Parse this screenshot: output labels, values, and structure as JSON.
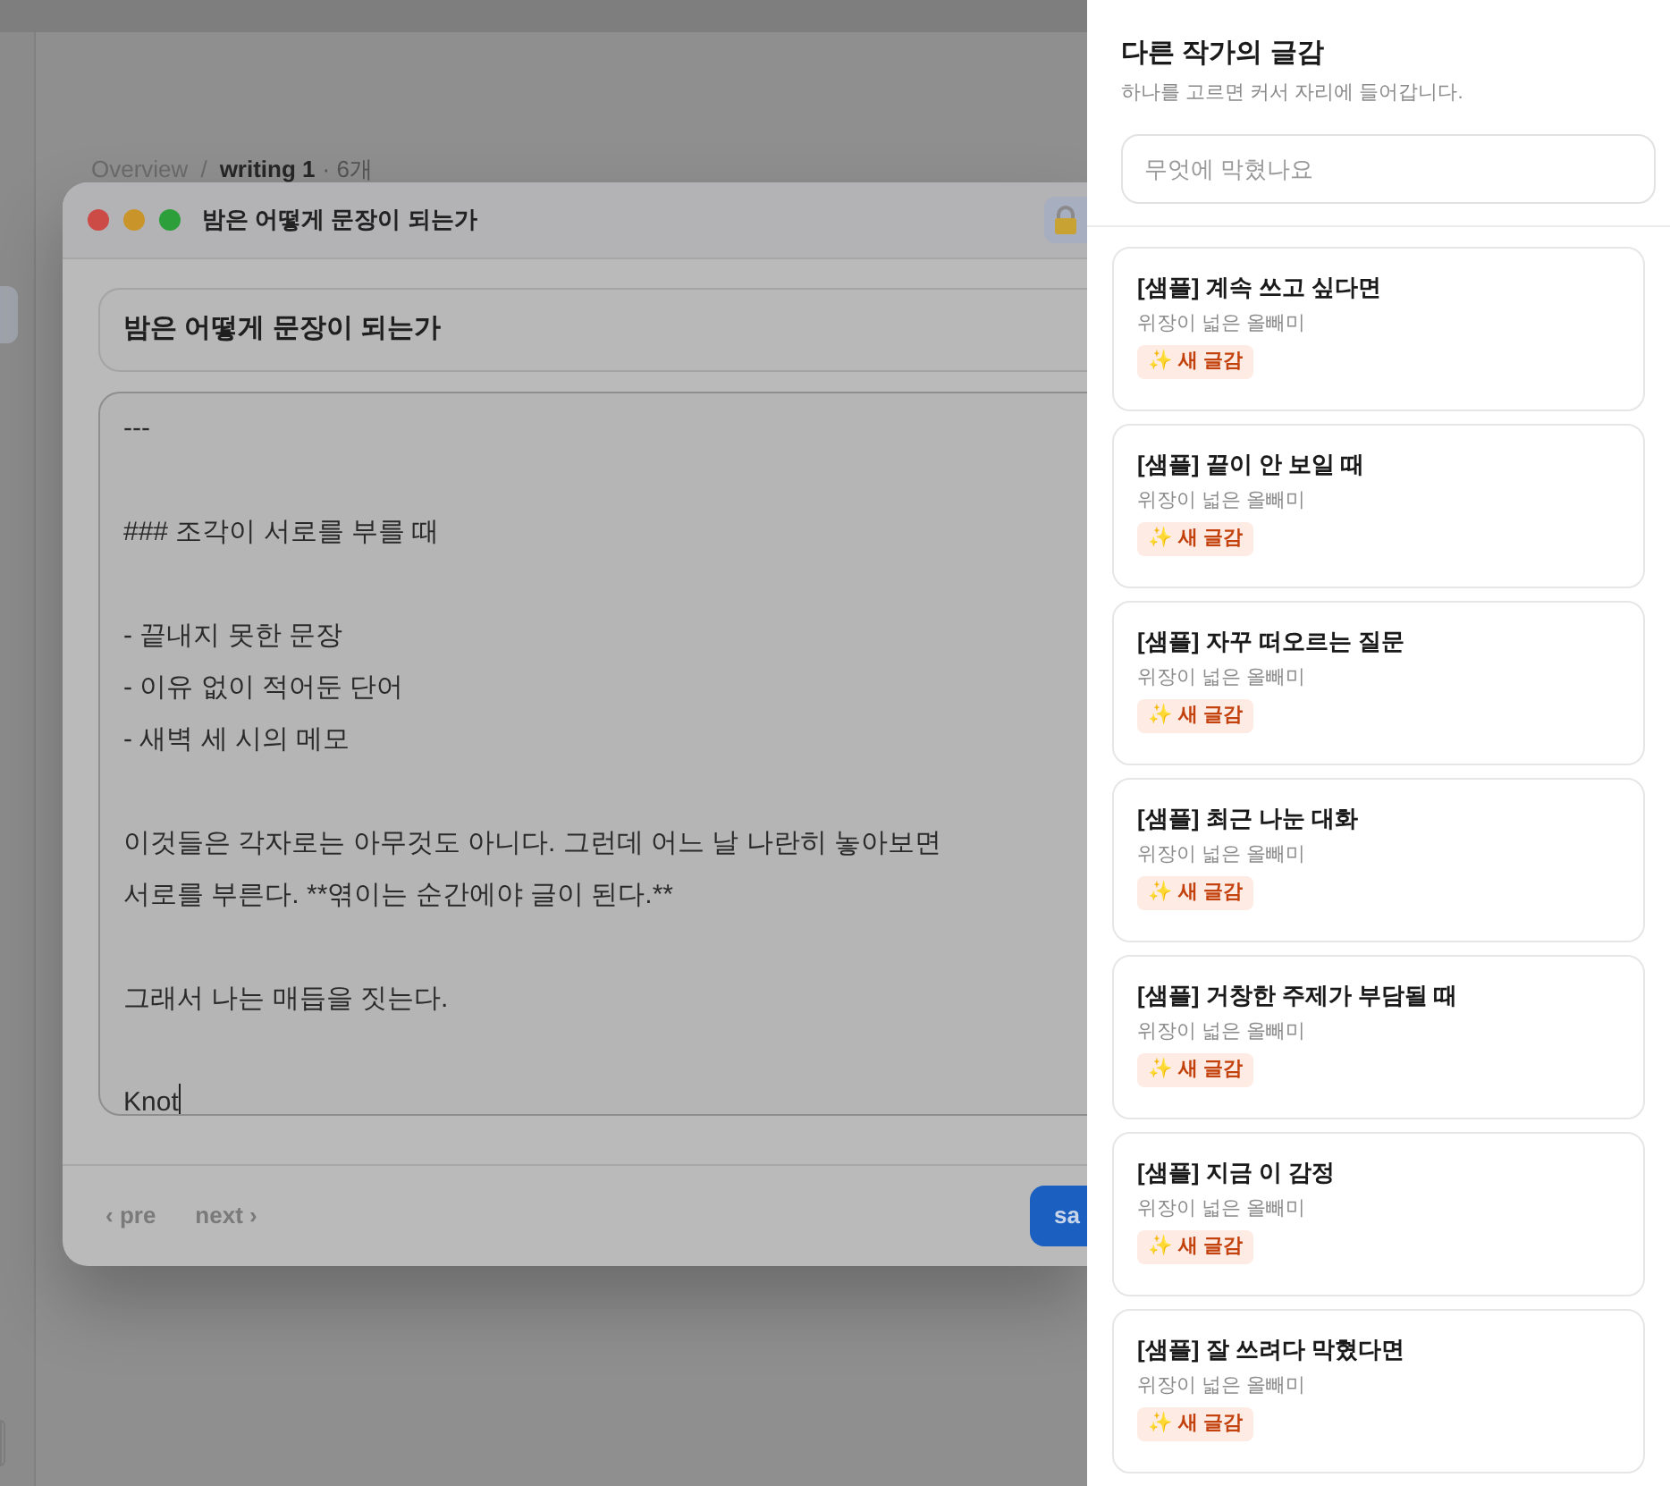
{
  "breadcrumb": {
    "root": "Overview",
    "separator": "/",
    "current": "writing 1",
    "count": "· 6개"
  },
  "dialog": {
    "title": "밤은 어떻게 문장이 되는가",
    "doc_title": "밤은 어떻게 문장이 되는가",
    "body": [
      [
        "---"
      ],
      [
        "### 조각이 서로를 부를 때"
      ],
      [
        "- 끝내지 못한 문장",
        "- 이유 없이 적어둔 단어",
        "- 새벽 세 시의 메모"
      ],
      [
        "이것들은 각자로는 아무것도 아니다. 그런데 어느 날 나란히 놓아보면",
        "서로를 부른다. **엮이는 순간에야 글이 된다.**"
      ],
      [
        "그래서 나는 매듭을 짓는다."
      ],
      [
        "Knot"
      ]
    ],
    "prev": "‹ pre",
    "next": "next ›",
    "save": "sa"
  },
  "panel": {
    "title": "다른 작가의 글감",
    "subtitle": "하나를 고르면 커서 자리에 들어갑니다.",
    "search": {
      "placeholder": "무엇에 막혔나요"
    },
    "cards": [
      {
        "title": "[샘플] 계속 쓰고 싶다면",
        "author": "위장이 넓은 올빼미",
        "badge": "✨ 새 글감"
      },
      {
        "title": "[샘플] 끝이 안 보일 때",
        "author": "위장이 넓은 올빼미",
        "badge": "✨ 새 글감"
      },
      {
        "title": "[샘플] 자꾸 떠오르는 질문",
        "author": "위장이 넓은 올빼미",
        "badge": "✨ 새 글감"
      },
      {
        "title": "[샘플] 최근 나눈 대화",
        "author": "위장이 넓은 올빼미",
        "badge": "✨ 새 글감"
      },
      {
        "title": "[샘플] 거창한 주제가 부담될 때",
        "author": "위장이 넓은 올빼미",
        "badge": "✨ 새 글감"
      },
      {
        "title": "[샘플] 지금 이 감정",
        "author": "위장이 넓은 올빼미",
        "badge": "✨ 새 글감"
      },
      {
        "title": "[샘플] 잘 쓰려다 막혔다면",
        "author": "위장이 넓은 올빼미",
        "badge": "✨ 새 글감"
      }
    ]
  }
}
